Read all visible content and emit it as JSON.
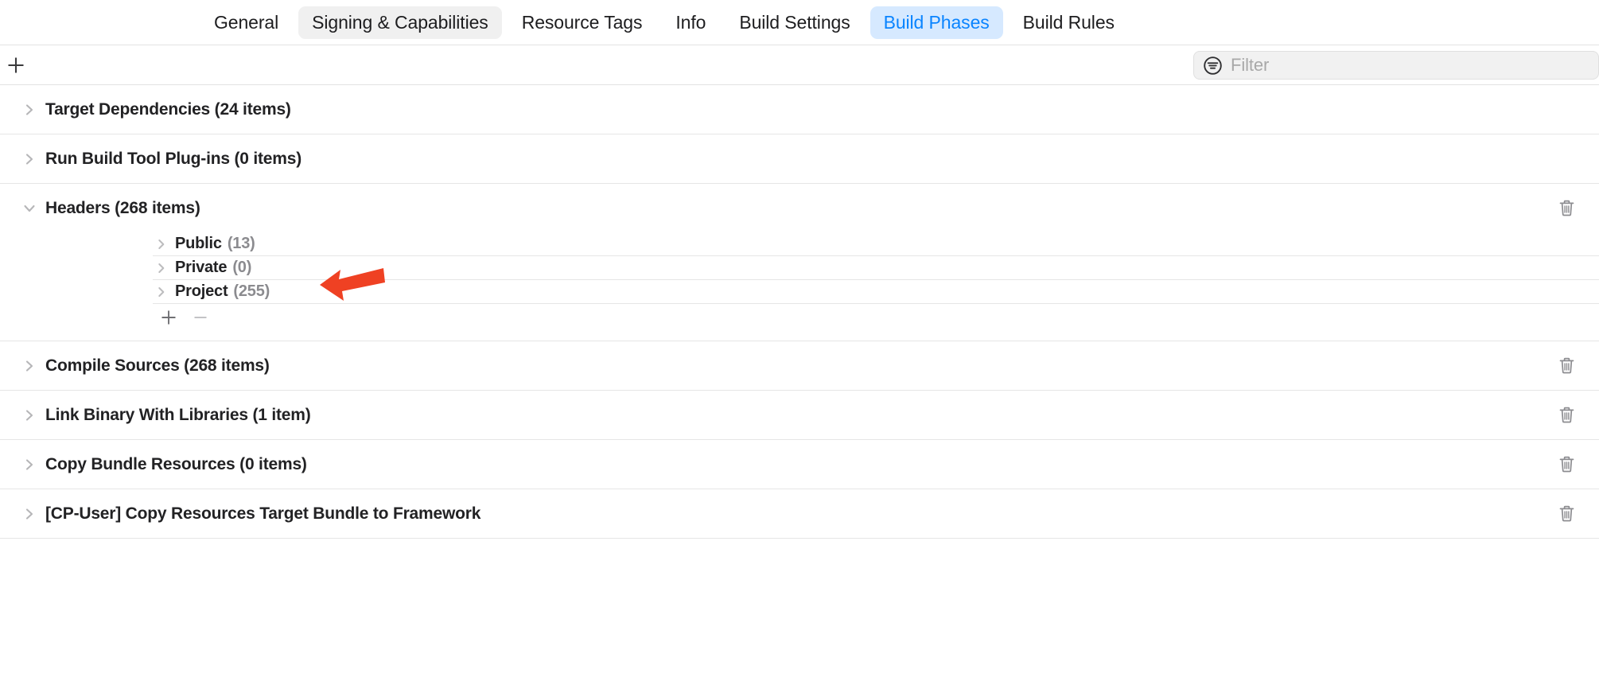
{
  "colors": {
    "accent_blue": "#0a84ff",
    "selected_tab_bg": "#d6e9ff",
    "hover_tab_bg": "#f0f0f0",
    "annotation_red": "#ef4123",
    "text_primary": "#222224",
    "text_secondary": "#8b8b8f",
    "separator": "#e6e6e6"
  },
  "tabs": [
    {
      "label": "General",
      "state": "normal"
    },
    {
      "label": "Signing & Capabilities",
      "state": "hovered"
    },
    {
      "label": "Resource Tags",
      "state": "normal"
    },
    {
      "label": "Info",
      "state": "normal"
    },
    {
      "label": "Build Settings",
      "state": "normal"
    },
    {
      "label": "Build Phases",
      "state": "selected"
    },
    {
      "label": "Build Rules",
      "state": "normal"
    }
  ],
  "toolbar": {
    "add_phase_label": "+",
    "add_phase_icon": "plus-icon",
    "filter_icon": "filter-circle-icon",
    "filter_placeholder": "Filter",
    "filter_value": ""
  },
  "phases": [
    {
      "title": "Target Dependencies (24 items)",
      "name": "target-dependencies",
      "expanded": false,
      "has_trash": false
    },
    {
      "title": "Run Build Tool Plug-ins (0 items)",
      "name": "run-build-tool-plugins",
      "expanded": false,
      "has_trash": false
    },
    {
      "title": "Headers (268 items)",
      "name": "headers",
      "expanded": true,
      "has_trash": true,
      "subgroups": [
        {
          "label": "Public",
          "count": "(13)",
          "name": "public"
        },
        {
          "label": "Private",
          "count": "(0)",
          "name": "private"
        },
        {
          "label": "Project",
          "count": "(255)",
          "name": "project"
        }
      ],
      "actions": {
        "add_label": "+",
        "remove_label": "—",
        "add_icon": "plus-icon",
        "remove_icon": "minus-icon"
      }
    },
    {
      "title": "Compile Sources (268 items)",
      "name": "compile-sources",
      "expanded": false,
      "has_trash": true
    },
    {
      "title": "Link Binary With Libraries (1 item)",
      "name": "link-binary-with-libraries",
      "expanded": false,
      "has_trash": true
    },
    {
      "title": "Copy Bundle Resources (0 items)",
      "name": "copy-bundle-resources",
      "expanded": false,
      "has_trash": true
    },
    {
      "title": "[CP-User] Copy Resources Target Bundle to Framework",
      "name": "cp-user-copy-resources",
      "expanded": false,
      "has_trash": true
    }
  ],
  "annotation": {
    "type": "arrow",
    "points_to": "Public (13)",
    "direction": "left"
  }
}
